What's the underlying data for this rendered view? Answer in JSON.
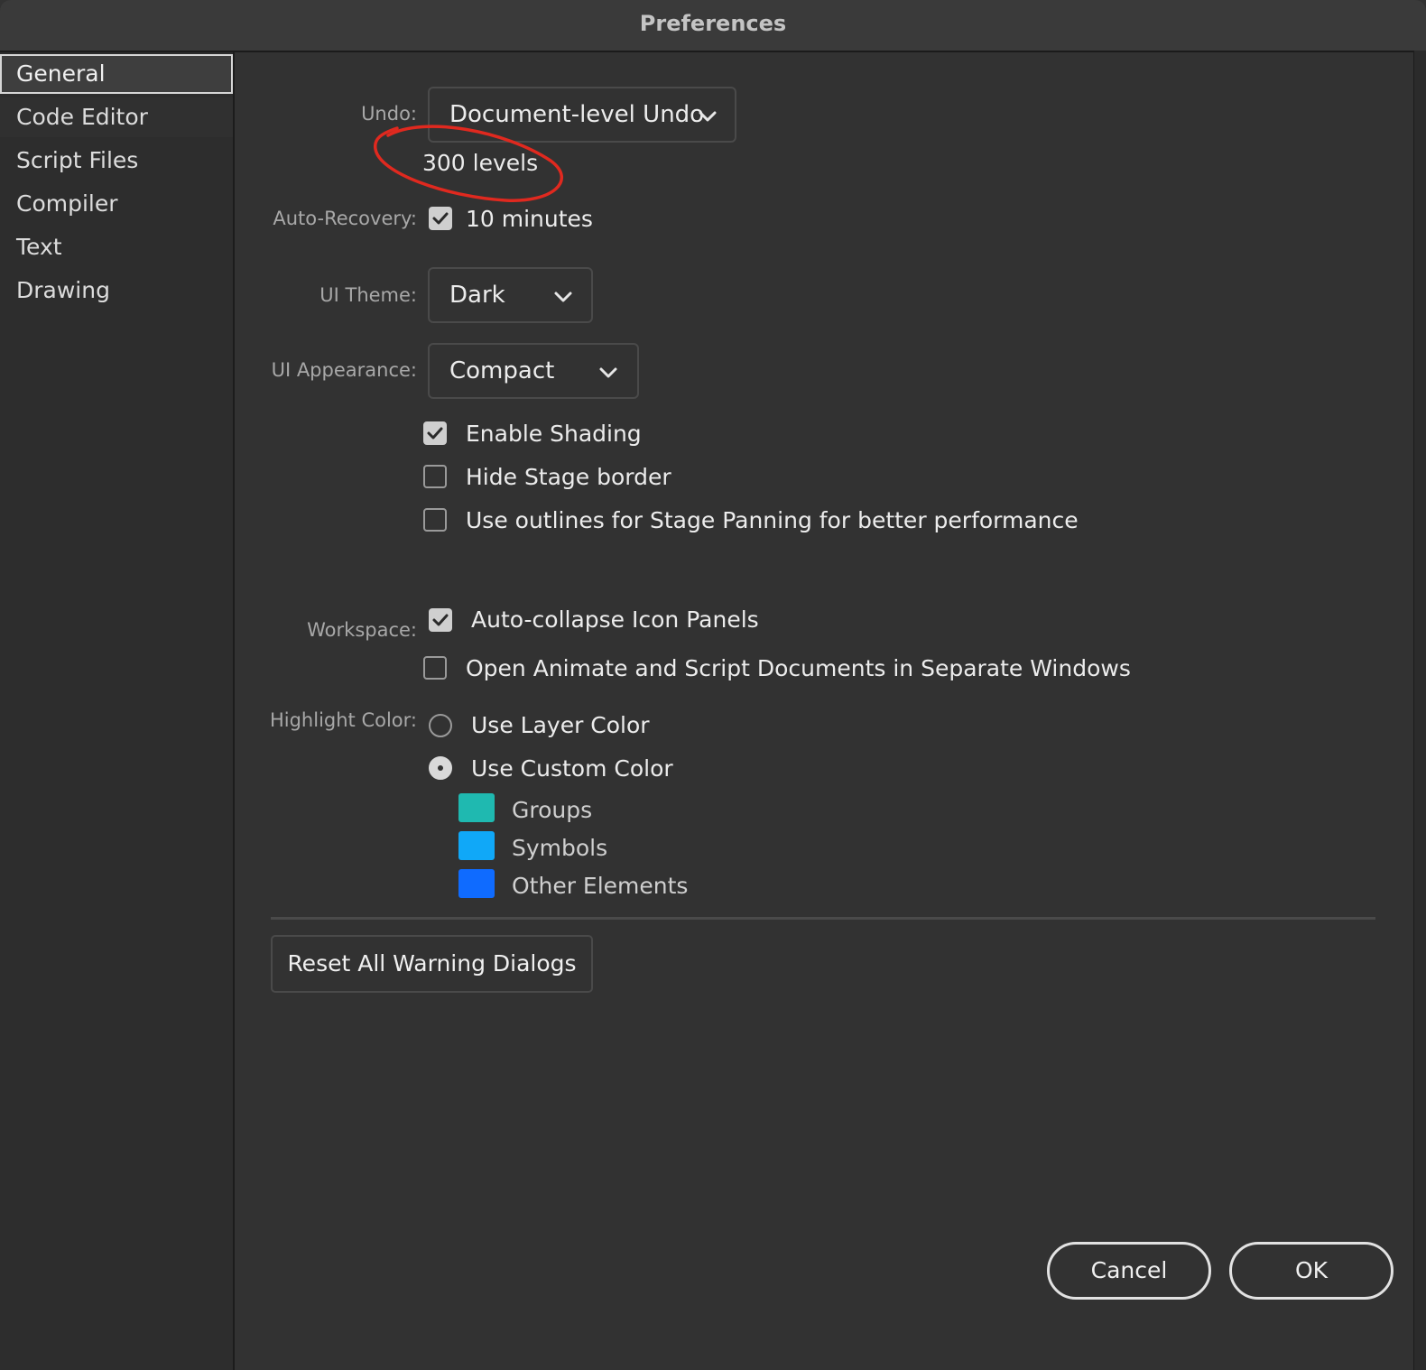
{
  "window": {
    "title": "Preferences"
  },
  "sidebar": {
    "items": [
      {
        "label": "General",
        "selected": true
      },
      {
        "label": "Code Editor"
      },
      {
        "label": "Script Files"
      },
      {
        "label": "Compiler"
      },
      {
        "label": "Text"
      },
      {
        "label": "Drawing"
      }
    ]
  },
  "general": {
    "undo": {
      "label": "Undo:",
      "value": "Document-level Undo",
      "levels": "300 levels"
    },
    "auto_recovery": {
      "label": "Auto-Recovery:",
      "checked": true,
      "text": "10 minutes"
    },
    "ui_theme": {
      "label": "UI Theme:",
      "value": "Dark"
    },
    "ui_appearance": {
      "label": "UI Appearance:",
      "value": "Compact"
    },
    "options": [
      {
        "label": "Enable Shading",
        "checked": true
      },
      {
        "label": "Hide Stage border",
        "checked": false
      },
      {
        "label": "Use outlines for Stage Panning for better performance",
        "checked": false
      }
    ],
    "workspace": {
      "label": "Workspace:",
      "options": [
        {
          "label": "Auto-collapse Icon Panels",
          "checked": true
        },
        {
          "label": "Open Animate and Script Documents in Separate Windows",
          "checked": false
        }
      ]
    },
    "highlight_color": {
      "label": "Highlight Color:",
      "options": [
        {
          "label": "Use Layer Color",
          "selected": false
        },
        {
          "label": "Use Custom Color",
          "selected": true
        }
      ],
      "swatches": [
        {
          "label": "Groups",
          "color": "#1fb9b0"
        },
        {
          "label": "Symbols",
          "color": "#10a8f8"
        },
        {
          "label": "Other Elements",
          "color": "#0f6bff"
        }
      ]
    },
    "reset_button": "Reset All Warning Dialogs"
  },
  "footer": {
    "cancel": "Cancel",
    "ok": "OK"
  },
  "annotation": {
    "color": "#e0291f"
  }
}
